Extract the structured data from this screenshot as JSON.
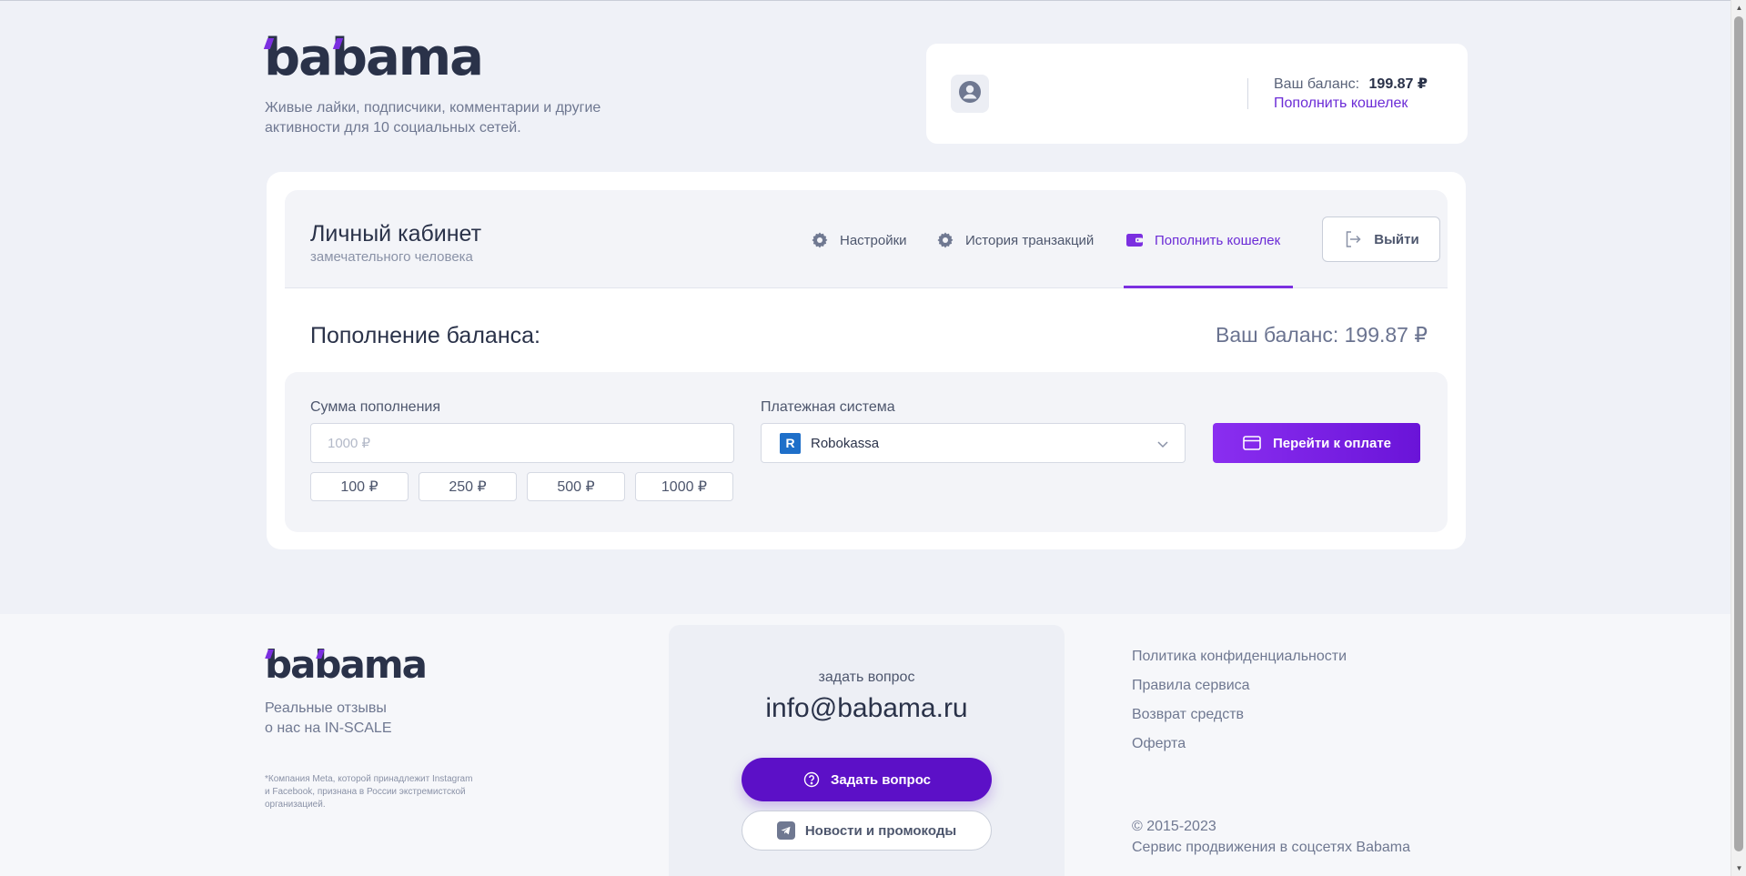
{
  "header": {
    "logo_text": "babama",
    "tagline": "Живые лайки, подписчики, комментарии и другие активности для 10 социальных сетей."
  },
  "user_card": {
    "balance_label": "Ваш баланс:",
    "balance_value": "199.87 ₽",
    "topup_link": "Пополнить кошелек"
  },
  "cabinet": {
    "title": "Личный кабинет",
    "subtitle": "замечательного человека",
    "nav": [
      {
        "label": "Настройки",
        "icon": "gear-icon"
      },
      {
        "label": "История транзакций",
        "icon": "gear-icon"
      },
      {
        "label": "Пополнить кошелек",
        "icon": "wallet-icon",
        "active": true
      }
    ],
    "logout_label": "Выйти"
  },
  "topup": {
    "title": "Пополнение баланса:",
    "balance_text": "Ваш баланс: 199.87 ₽",
    "amount_label": "Сумма пополнения",
    "amount_placeholder": "1000 ₽",
    "amount_value": "",
    "quick_amounts": [
      "100 ₽",
      "250 ₽",
      "500 ₽",
      "1000 ₽"
    ],
    "payment_label": "Платежная система",
    "payment_selected": "Robokassa",
    "payment_logo_letter": "R",
    "pay_button": "Перейти к оплате"
  },
  "footer": {
    "logo_text": "babama",
    "reviews_line1": "Реальные отзывы",
    "reviews_line2": "о нас на IN-SCALE",
    "disclaimer": "*Компания Meta, которой принадлежит Instagram и Facebook, признана в России экстремистской организацией.",
    "ask_label": "задать вопрос",
    "email": "info@babama.ru",
    "ask_button": "Задать вопрос",
    "news_button": "Новости и промокоды",
    "links": [
      "Политика конфиденциальности",
      "Правила сервиса",
      "Возврат средств",
      "Оферта"
    ],
    "copyright_line1": "© 2015-2023",
    "copyright_line2": "Сервис продвижения в соцсетях Babama"
  },
  "colors": {
    "accent": "#7b2fe0",
    "accent_dark": "#5c10c7",
    "text_dark": "#2a3249",
    "text_muted": "#6f7891",
    "background": "#eff1f7"
  }
}
